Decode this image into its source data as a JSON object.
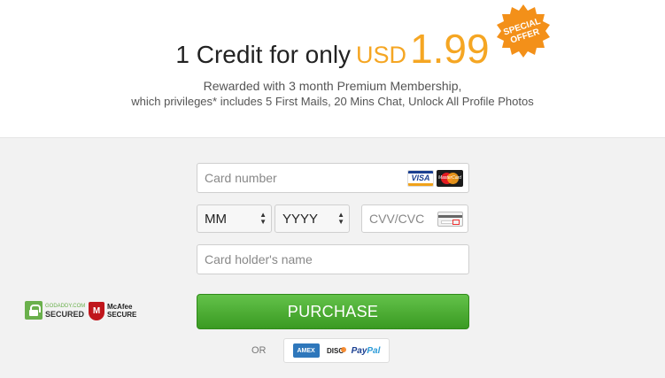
{
  "offer": {
    "headline": "1 Credit for only",
    "currency": "USD",
    "price": "1.99",
    "badge_line1": "SPECIAL",
    "badge_line2": "OFFER",
    "subtitle_line1": "Rewarded with 3 month Premium Membership,",
    "subtitle_line2": "which privileges* includes 5 First Mails, 20 Mins Chat, Unlock All Profile Photos"
  },
  "form": {
    "card_number_placeholder": "Card number",
    "month_value": "MM",
    "year_value": "YYYY",
    "cvv_placeholder": "CVV/CVC",
    "holder_placeholder": "Card holder's name",
    "purchase_label": "PURCHASE",
    "card_logos": {
      "visa": "VISA",
      "mastercard": "MasterCard"
    }
  },
  "alternatives": {
    "or_label": "OR",
    "amex": "AMEX",
    "discover": "DISC",
    "paypal_pay": "Pay",
    "paypal_pal": "Pal"
  },
  "trust": {
    "godaddy_line1": "GODADDY.COM",
    "godaddy_line2": "SECURED",
    "mcafee_shield": "M",
    "mcafee_line1": "McAfee",
    "mcafee_line2": "SECURE"
  },
  "colors": {
    "accent": "#f5a623",
    "purchase_green": "#4caf2e",
    "badge_orange": "#f39019"
  }
}
